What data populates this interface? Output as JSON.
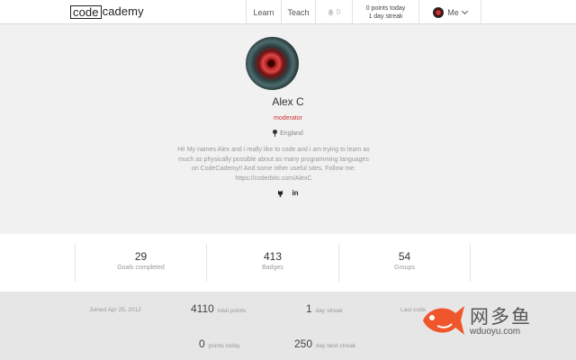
{
  "header": {
    "logo_box": "code",
    "logo_rest": "cademy",
    "nav": {
      "learn": "Learn",
      "teach": "Teach"
    },
    "notifications_count": "0",
    "points_today": "0 points today",
    "day_streak": "1 day streak",
    "me": "Me"
  },
  "profile": {
    "name": "Alex C",
    "role": "moderator",
    "location": "England",
    "bio": "Hi! My names Alex and i really like to code and i am trying to learn as much as physically possible about as many programming languages on CodeCademy!! And some other useful sites. Follow me: https://coderbits.com/AlexC",
    "linkedin": "in"
  },
  "stats": [
    {
      "value": "29",
      "label": "Goals completed"
    },
    {
      "value": "413",
      "label": "Badges"
    },
    {
      "value": "54",
      "label": "Groups"
    }
  ],
  "summary": {
    "joined": "Joined Apr 25, 2012",
    "total_points_value": "4110",
    "total_points_label": "total points",
    "day_streak_value": "1",
    "day_streak_label": "day streak",
    "last_code_partial": "Last code",
    "points_today_value": "0",
    "points_today_label": "points today",
    "best_streak_value": "250",
    "best_streak_label": "day best streak"
  },
  "watermark": {
    "cn": "网多鱼",
    "en": "wduoyu.com"
  },
  "colors": {
    "accent_red": "#d0312d",
    "profile_bg": "#f1f1f1",
    "bottom_bg": "#e6e6e6",
    "watermark_orange": "#f0562c"
  }
}
